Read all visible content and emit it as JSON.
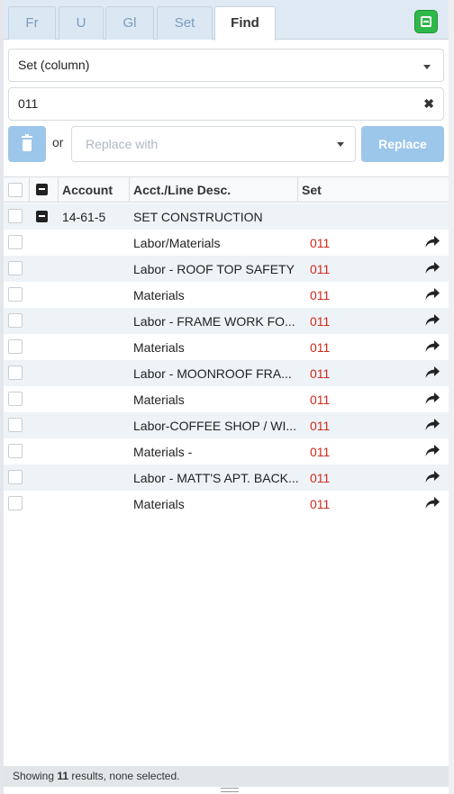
{
  "tabs": [
    {
      "label": "Fr"
    },
    {
      "label": "U"
    },
    {
      "label": "Gl"
    },
    {
      "label": "Set"
    },
    {
      "label": "Find"
    }
  ],
  "find": {
    "field_select": "Set (column)",
    "search_value": "011",
    "or_label": "or",
    "replace_placeholder": "Replace with",
    "replace_button": "Replace"
  },
  "grid": {
    "headers": {
      "account": "Account",
      "desc": "Acct./Line Desc.",
      "set": "Set"
    },
    "group": {
      "account": "14-61-5",
      "desc": "SET CONSTRUCTION"
    },
    "rows": [
      {
        "desc": "Labor/Materials",
        "set": "011"
      },
      {
        "desc": "Labor - ROOF TOP SAFETY",
        "set": "011"
      },
      {
        "desc": "Materials",
        "set": "011"
      },
      {
        "desc": "Labor - FRAME WORK FO...",
        "set": "011"
      },
      {
        "desc": "Materials",
        "set": "011"
      },
      {
        "desc": "Labor - MOONROOF FRA...",
        "set": "011"
      },
      {
        "desc": "Materials",
        "set": "011"
      },
      {
        "desc": "Labor-COFFEE SHOP / WI...",
        "set": "011"
      },
      {
        "desc": "Materials -",
        "set": "011"
      },
      {
        "desc": "Labor - MATT'S APT. BACK...",
        "set": "011"
      },
      {
        "desc": "Materials",
        "set": "011"
      }
    ]
  },
  "status": {
    "prefix": "Showing ",
    "count": "11",
    "suffix": " results, none selected."
  },
  "colors": {
    "accent_disabled": "#9cc6ea",
    "set_value": "#d02a1b",
    "toggle": "#2fb84a"
  }
}
